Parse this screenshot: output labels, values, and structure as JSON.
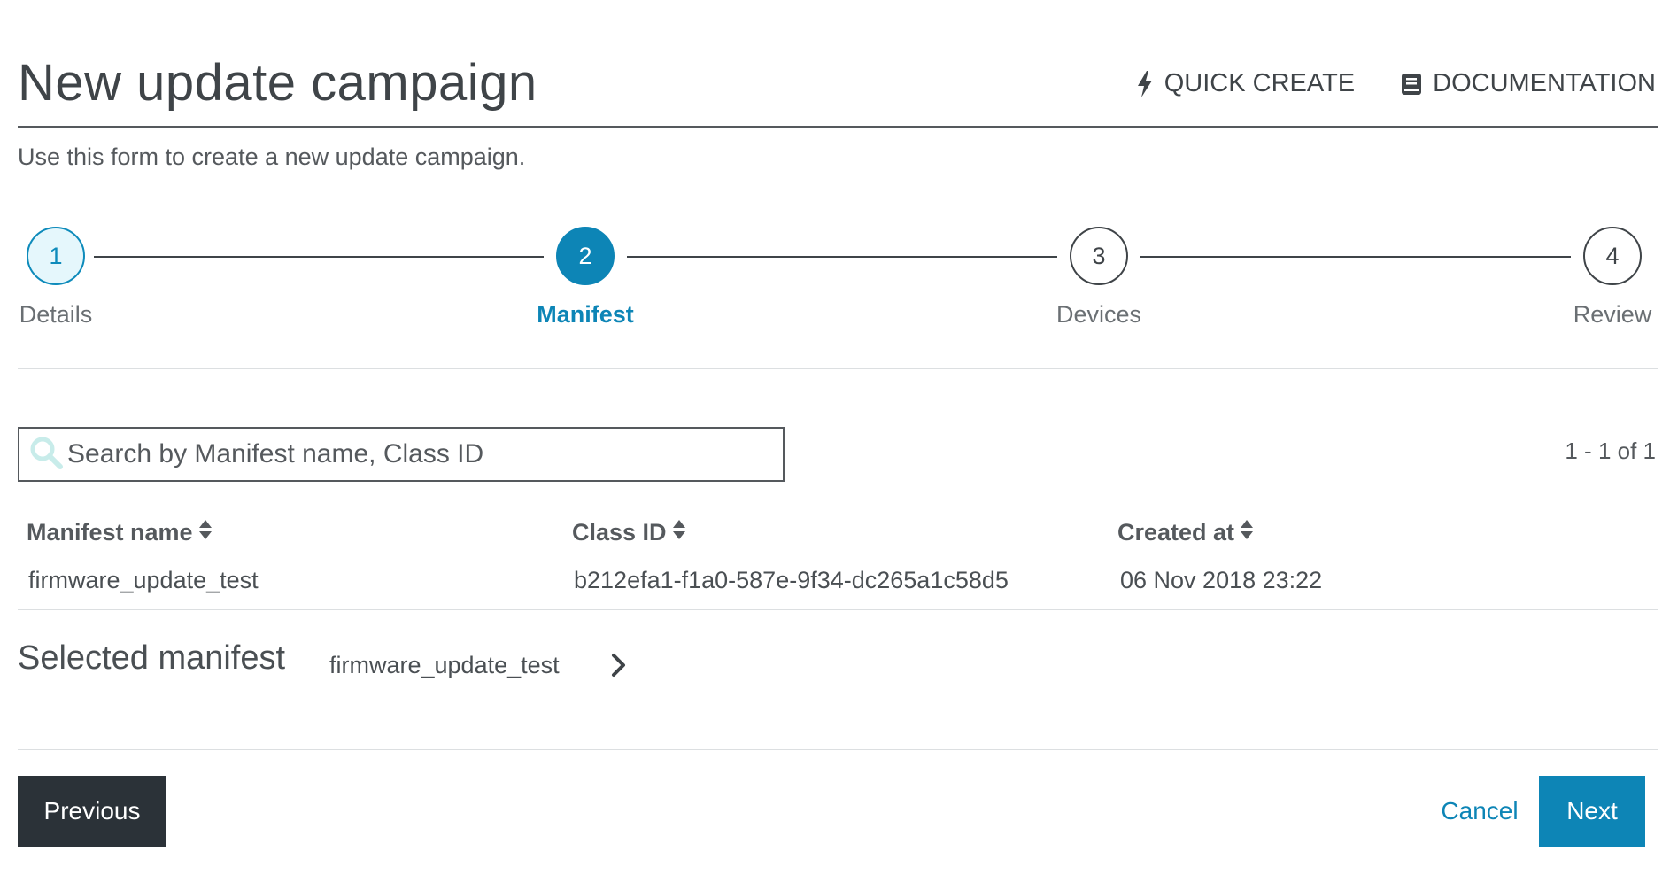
{
  "header": {
    "title": "New update campaign",
    "quick_create": "QUICK CREATE",
    "quick_create_icon": "lightning-bolt-icon",
    "documentation": "DOCUMENTATION",
    "documentation_icon": "book-icon"
  },
  "subtitle": "Use this form to create a new update campaign.",
  "stepper": {
    "steps": [
      {
        "number": "1",
        "label": "Details",
        "state": "completed"
      },
      {
        "number": "2",
        "label": "Manifest",
        "state": "active"
      },
      {
        "number": "3",
        "label": "Devices",
        "state": "pending"
      },
      {
        "number": "4",
        "label": "Review",
        "state": "pending"
      }
    ],
    "colors": {
      "active": "#0d85b6",
      "completed_fill": "#e5f7fc"
    }
  },
  "search": {
    "placeholder": "Search by Manifest name, Class ID",
    "value": "",
    "icon": "search-icon"
  },
  "pagination": "1 - 1 of 1",
  "table": {
    "columns": [
      "Manifest name",
      "Class ID",
      "Created at"
    ],
    "rows": [
      {
        "manifest_name": "firmware_update_test",
        "class_id": "b212efa1-f1a0-587e-9f34-dc265a1c58d5",
        "created_at": "06 Nov 2018 23:22"
      }
    ]
  },
  "selected": {
    "label": "Selected manifest",
    "value": "firmware_update_test",
    "icon": "chevron-right-icon"
  },
  "buttons": {
    "previous": "Previous",
    "cancel": "Cancel",
    "next": "Next"
  },
  "colors": {
    "accent": "#0d85b6",
    "dark_button": "#2b3238",
    "text": "#3f4448"
  }
}
